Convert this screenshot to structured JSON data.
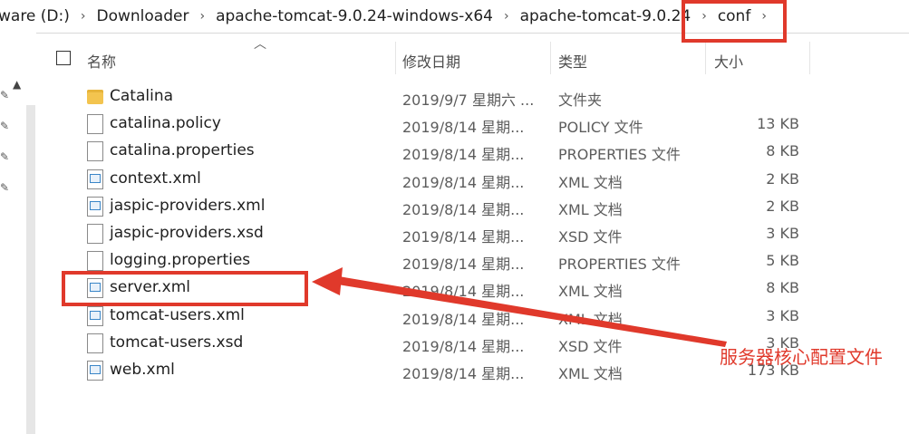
{
  "breadcrumb": {
    "items": [
      "ware (D:)",
      "Downloader",
      "apache-tomcat-9.0.24-windows-x64",
      "apache-tomcat-9.0.24",
      "conf"
    ],
    "separator": "›"
  },
  "columns": {
    "name": "名称",
    "date": "修改日期",
    "type": "类型",
    "size": "大小"
  },
  "files": [
    {
      "name": "Catalina",
      "date": "2019/9/7 星期六 ...",
      "type": "文件夹",
      "size": "",
      "icon": "folder-icon"
    },
    {
      "name": "catalina.policy",
      "date": "2019/8/14 星期...",
      "type": "POLICY 文件",
      "size": "13 KB",
      "icon": "file-icon"
    },
    {
      "name": "catalina.properties",
      "date": "2019/8/14 星期...",
      "type": "PROPERTIES 文件",
      "size": "8 KB",
      "icon": "file-icon"
    },
    {
      "name": "context.xml",
      "date": "2019/8/14 星期...",
      "type": "XML 文档",
      "size": "2 KB",
      "icon": "xml-file-icon"
    },
    {
      "name": "jaspic-providers.xml",
      "date": "2019/8/14 星期...",
      "type": "XML 文档",
      "size": "2 KB",
      "icon": "xml-file-icon"
    },
    {
      "name": "jaspic-providers.xsd",
      "date": "2019/8/14 星期...",
      "type": "XSD 文件",
      "size": "3 KB",
      "icon": "file-icon"
    },
    {
      "name": "logging.properties",
      "date": "2019/8/14 星期...",
      "type": "PROPERTIES 文件",
      "size": "5 KB",
      "icon": "file-icon"
    },
    {
      "name": "server.xml",
      "date": "2019/8/14 星期...",
      "type": "XML 文档",
      "size": "8 KB",
      "icon": "xml-file-icon"
    },
    {
      "name": "tomcat-users.xml",
      "date": "2019/8/14 星期...",
      "type": "XML 文档",
      "size": "3 KB",
      "icon": "xml-file-icon"
    },
    {
      "name": "tomcat-users.xsd",
      "date": "2019/8/14 星期...",
      "type": "XSD 文件",
      "size": "3 KB",
      "icon": "file-icon"
    },
    {
      "name": "web.xml",
      "date": "2019/8/14 星期...",
      "type": "XML 文档",
      "size": "173 KB",
      "icon": "xml-file-icon"
    }
  ],
  "annotation": {
    "label": "服务器核心配置文件",
    "color": "#e0392b"
  }
}
